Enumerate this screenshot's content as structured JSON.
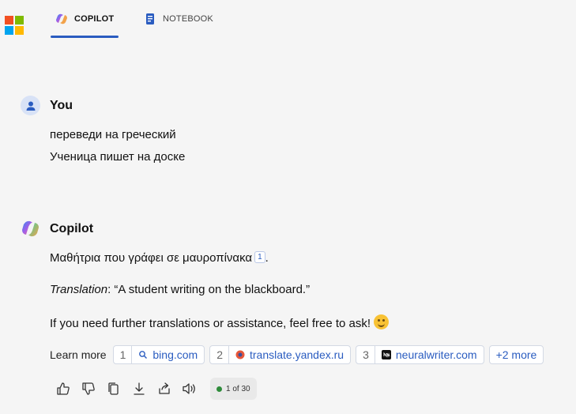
{
  "header": {
    "tabs": [
      {
        "label": "COPILOT",
        "active": true
      },
      {
        "label": "NOTEBOOK",
        "active": false
      }
    ],
    "logo_colors": [
      "#f25022",
      "#7fba00",
      "#00a4ef",
      "#ffb900"
    ],
    "accent": "#2a5cc0"
  },
  "conversation": {
    "user": {
      "name": "You",
      "lines": [
        "переведи на греческий",
        "Ученица пишет на доске"
      ]
    },
    "copilot": {
      "name": "Copilot",
      "greek": "Μαθήτρια που γράφει σε μαυροπίνακα",
      "greek_citation": "1",
      "translation_label": "Translation",
      "translation_text": ": “A student writing on the blackboard.”",
      "followup": "If you need further translations or assistance, feel free to ask!",
      "learn_more": "Learn more",
      "sources": [
        {
          "num": "1",
          "domain": "bing.com",
          "icon": "search-icon"
        },
        {
          "num": "2",
          "domain": "translate.yandex.ru",
          "icon": "yandex-icon"
        },
        {
          "num": "3",
          "domain": "neuralwriter.com",
          "icon": "neuralwriter-icon"
        }
      ],
      "more_sources": "+2 more",
      "counter": "1 of 30",
      "counter_dot_color": "#2e8b3a"
    }
  },
  "actions": [
    "thumbs-up-icon",
    "thumbs-down-icon",
    "copy-icon",
    "download-icon",
    "share-icon",
    "read-aloud-icon"
  ]
}
